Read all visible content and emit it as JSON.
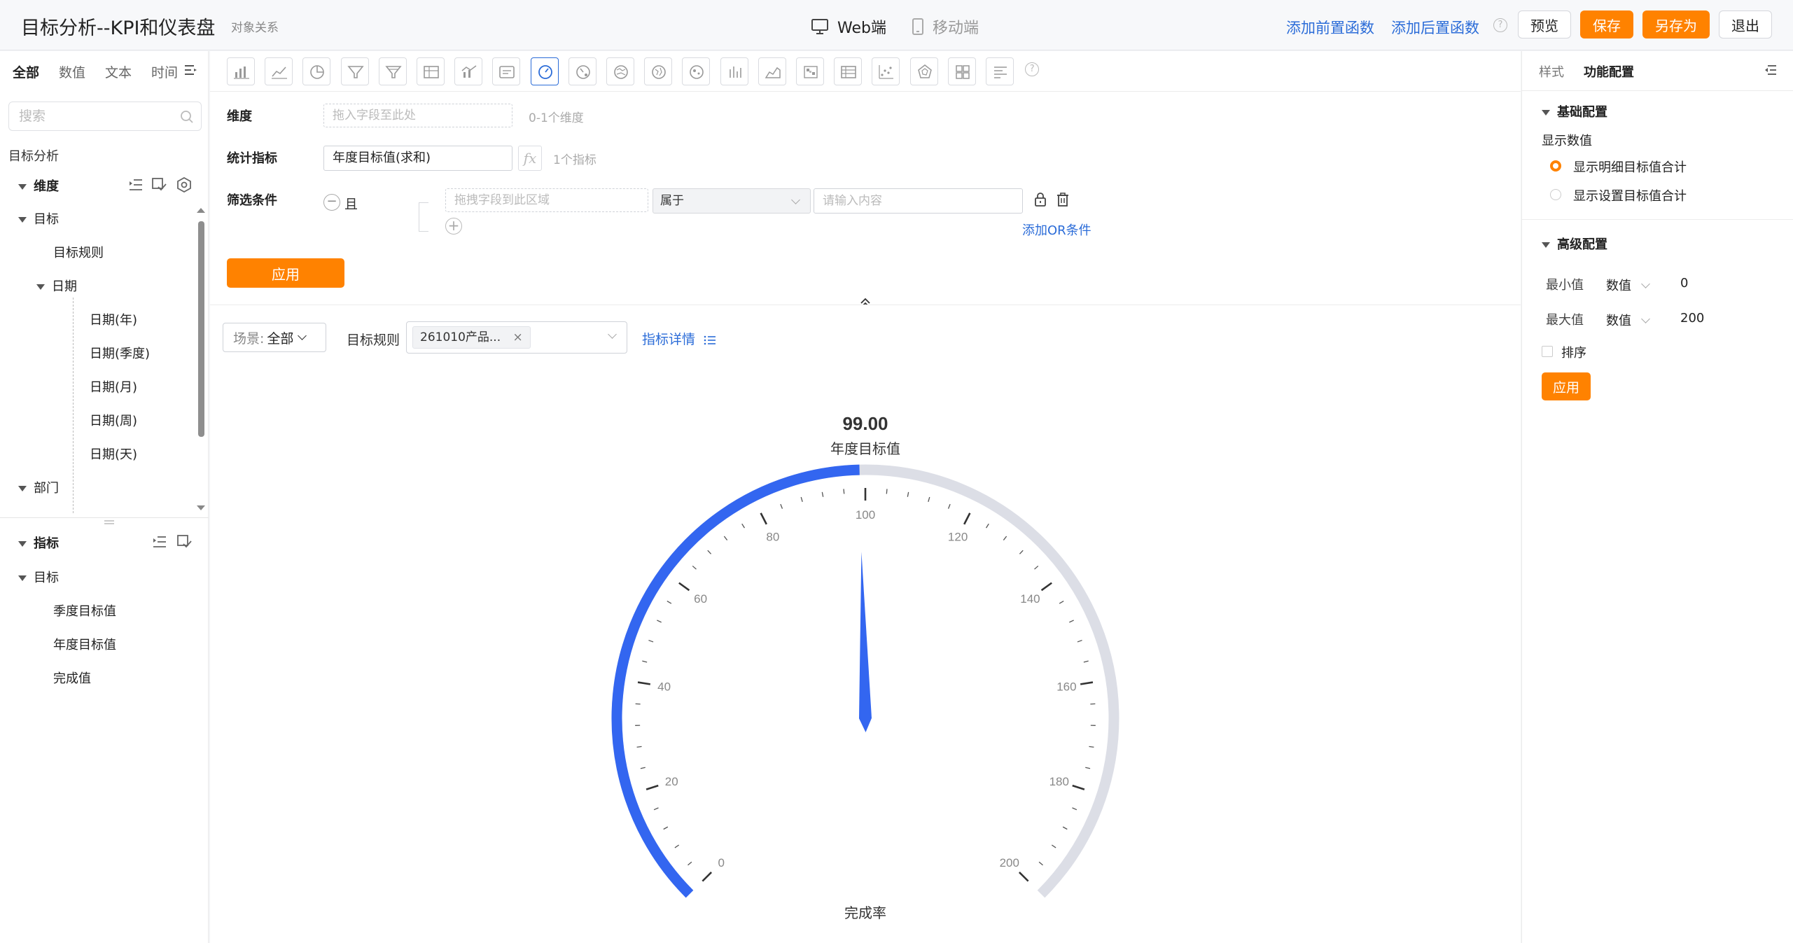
{
  "header": {
    "title": "目标分析--KPI和仪表盘",
    "relation_link": "对象关系",
    "device_web": "Web端",
    "device_mobile": "移动端",
    "add_pre_func": "添加前置函数",
    "add_post_func": "添加后置函数",
    "help": "?",
    "preview": "预览",
    "save": "保存",
    "save_as": "另存为",
    "exit": "退出"
  },
  "left_panel": {
    "tabs": [
      "全部",
      "数值",
      "文本",
      "时间"
    ],
    "search_placeholder": "搜索",
    "dataset": "目标分析",
    "dimension_group": "维度",
    "dimension_tree": {
      "target": "目标",
      "target_rule": "目标规则",
      "date": "日期",
      "date_year": "日期(年)",
      "date_quarter": "日期(季度)",
      "date_month": "日期(月)",
      "date_week": "日期(周)",
      "date_day": "日期(天)",
      "department": "部门"
    },
    "metric_group": "指标",
    "metric_tree": {
      "target": "目标",
      "quarter_target": "季度目标值",
      "annual_target": "年度目标值",
      "completion": "完成值"
    }
  },
  "toolbar": {
    "chart_icons": [
      "bar-chart-icon",
      "line-chart-icon",
      "pie-chart-icon",
      "funnel-icon",
      "funnel-alt-icon",
      "table-icon",
      "combo-chart-icon",
      "text-card-icon",
      "gauge-icon",
      "gauge-alt-icon",
      "map-icon",
      "geo-map-icon",
      "bubble-map-icon",
      "column-icon",
      "area-icon",
      "heatmap-icon",
      "pivot-table-icon",
      "scatter-icon",
      "radar-icon",
      "grid-icon",
      "list-icon"
    ],
    "active_icon": "gauge-icon",
    "help": "?"
  },
  "config": {
    "dimension_label": "维度",
    "dimension_placeholder": "拖入字段至此处",
    "dimension_hint": "0-1个维度",
    "metric_label": "统计指标",
    "metric_value": "年度目标值(求和)",
    "fx": "fx",
    "metric_hint": "1个指标",
    "filter_label": "筛选条件",
    "logic_minus": "−",
    "logic_and": "且",
    "filter_field_placeholder": "拖拽字段到此区域",
    "filter_operator": "属于",
    "filter_value_placeholder": "请输入内容",
    "add_or": "添加OR条件",
    "apply": "应用"
  },
  "plot": {
    "scene_label": "场景:",
    "scene_value": "全部",
    "rule_label": "目标规则",
    "rule_tag": "261010产品...",
    "rule_tag_close": "×",
    "detail_link": "指标详情",
    "gauge_value_text": "99.00",
    "gauge_caption": "年度目标值",
    "gauge_bottom_label": "完成率"
  },
  "chart_data": {
    "type": "gauge",
    "value": 99.0,
    "min": 0,
    "max": 200,
    "major_ticks": [
      0,
      20,
      40,
      60,
      80,
      100,
      120,
      140,
      160,
      180,
      200
    ],
    "value_label": "99.00",
    "series_name": "年度目标值",
    "bottom_label": "完成率",
    "progress_color": "#3366f0",
    "track_color": "#dcdee6",
    "pointer_color": "#3366f0"
  },
  "right_panel": {
    "tabs": [
      "样式",
      "功能配置"
    ],
    "basic_section": "基础配置",
    "display_value_label": "显示数值",
    "radio_detail": "显示明细目标值合计",
    "radio_set": "显示设置目标值合计",
    "advanced_section": "高级配置",
    "min_label": "最小值",
    "min_type": "数值",
    "min_value": "0",
    "max_label": "最大值",
    "max_type": "数值",
    "max_value": "200",
    "sort_label": "排序",
    "apply": "应用"
  }
}
